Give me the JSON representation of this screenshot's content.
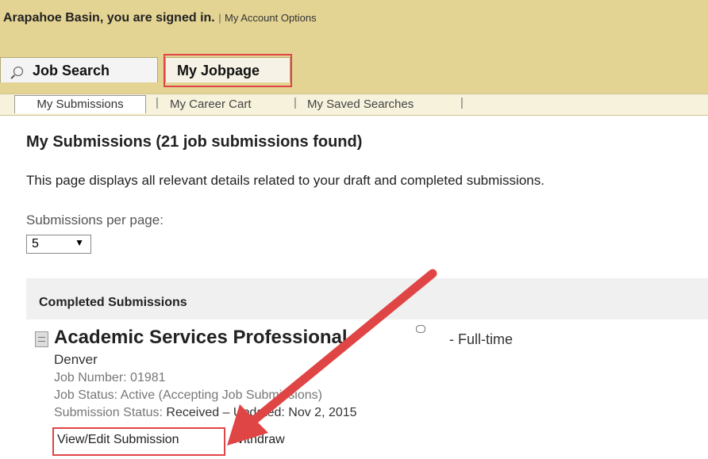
{
  "header": {
    "signed_in_text": "Arapahoe Basin, you are signed in.",
    "separator": "|",
    "account_options": "My Account Options"
  },
  "tabs": [
    {
      "label": "Job Search",
      "icon": "search-icon"
    },
    {
      "label": "My Jobpage"
    }
  ],
  "subnav": {
    "items": [
      "My Submissions",
      "My Career Cart",
      "My Saved Searches"
    ],
    "separator": "|"
  },
  "page": {
    "title": "My Submissions (21 job submissions found)",
    "description": "This page displays all relevant details related to your draft and completed submissions.",
    "per_page_label": "Submissions per page:",
    "per_page_value": "5",
    "per_page_arrow": "▼"
  },
  "completed": {
    "section_title": "Completed Submissions",
    "job": {
      "title": "Academic Services Professional",
      "type": "- Full-time",
      "location": "Denver",
      "job_number_label": "Job Number: 01981",
      "job_status_label": "Job Status: Active (Accepting Job Submissions)",
      "submission_status_label": "Submission Status:",
      "submission_status_value": "Received – Updated: Nov 2, 2015",
      "actions": [
        "View/Edit Submission",
        "Withdraw"
      ]
    }
  },
  "colors": {
    "header_bg": "#e4d494",
    "highlight": "#e04545",
    "subnav_bg": "#f6f2dc"
  }
}
